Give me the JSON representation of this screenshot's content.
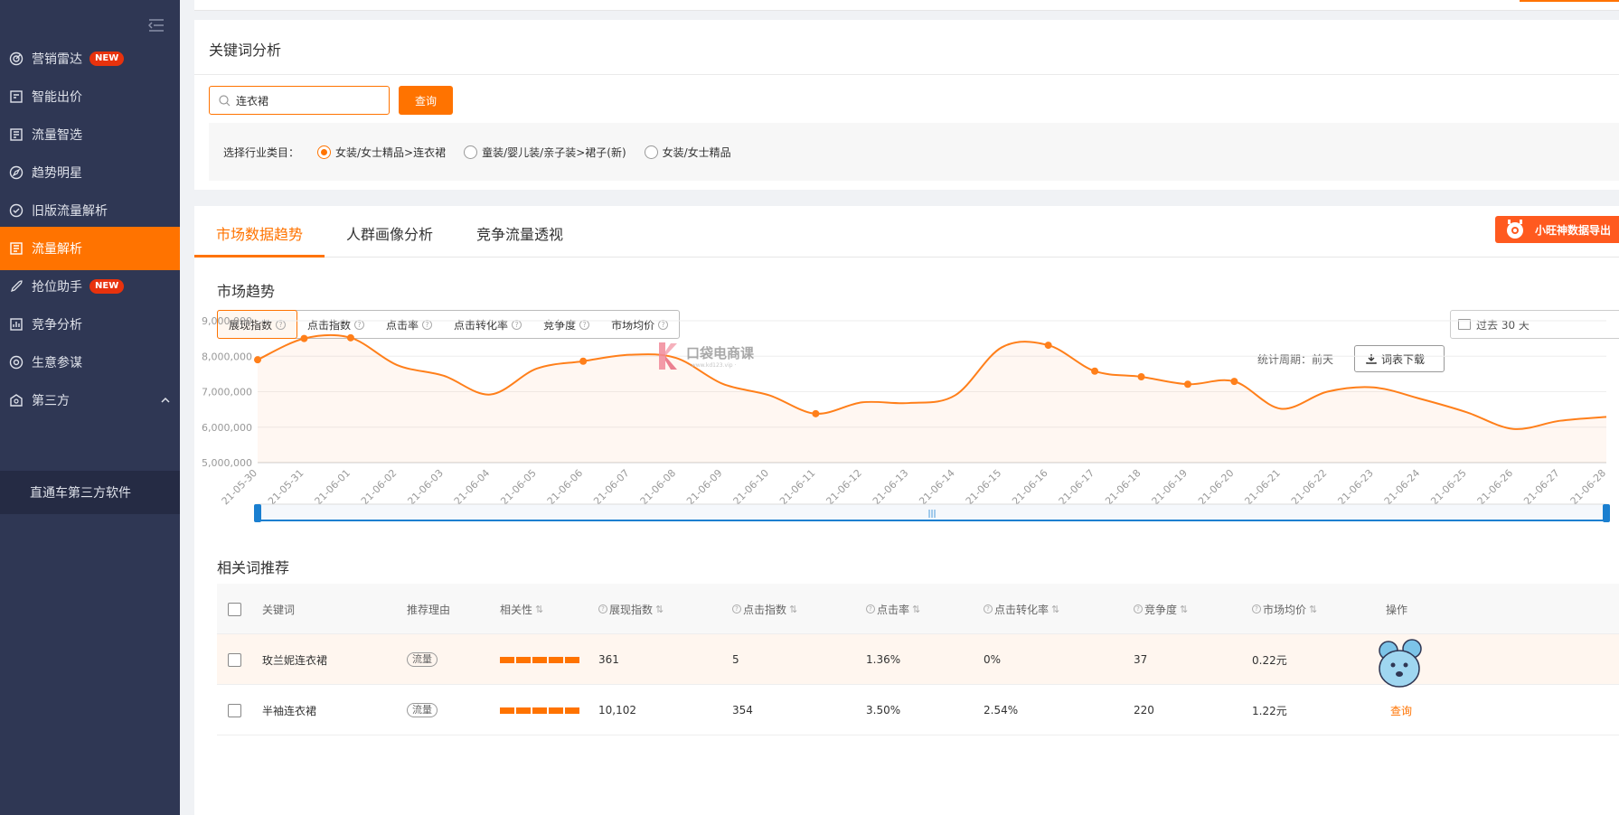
{
  "sidebar": {
    "items": [
      {
        "label": "营销雷达",
        "badge": "NEW",
        "icon": "radar-icon"
      },
      {
        "label": "智能出价",
        "badge": "",
        "icon": "bid-icon"
      },
      {
        "label": "流量智选",
        "badge": "",
        "icon": "traffic-select-icon"
      },
      {
        "label": "趋势明星",
        "badge": "",
        "icon": "trend-star-icon"
      },
      {
        "label": "旧版流量解析",
        "badge": "",
        "icon": "old-analysis-icon"
      },
      {
        "label": "流量解析",
        "badge": "",
        "icon": "analysis-icon",
        "active": true
      },
      {
        "label": "抢位助手",
        "badge": "NEW",
        "icon": "rocket-icon"
      },
      {
        "label": "竞争分析",
        "badge": "",
        "icon": "compete-icon"
      },
      {
        "label": "生意参谋",
        "badge": "",
        "icon": "advisor-icon"
      },
      {
        "label": "第三方",
        "badge": "",
        "icon": "third-party-icon",
        "expanded": true
      }
    ],
    "sub_item": "直通车第三方软件"
  },
  "keyword_card": {
    "title": "关键词分析",
    "search_value": "连衣裙",
    "query_label": "查询",
    "industry_label": "选择行业类目：",
    "industries": [
      {
        "label": "女装/女士精品>连衣裙",
        "checked": true
      },
      {
        "label": "童装/婴儿装/亲子装>裙子(新)",
        "checked": false
      },
      {
        "label": "女装/女士精品",
        "checked": false
      }
    ]
  },
  "tabs": [
    "市场数据趋势",
    "人群画像分析",
    "竞争流量透视"
  ],
  "export_label": "小旺神数据导出",
  "market": {
    "title": "市场趋势",
    "metric_tabs": [
      "展现指数",
      "点击指数",
      "点击率",
      "点击转化率",
      "竞争度",
      "市场均价"
    ],
    "date_range": "过去 30 天"
  },
  "chart_data": {
    "type": "line",
    "series": [
      {
        "name": "展现指数",
        "values": [
          7900000,
          8500000,
          8520000,
          7750000,
          7450000,
          6920000,
          7650000,
          7860000,
          8040000,
          7950000,
          7220000,
          6900000,
          6380000,
          6700000,
          6680000,
          6900000,
          8250000,
          8310000,
          7580000,
          7420000,
          7210000,
          7290000,
          6520000,
          7000000,
          7120000,
          6800000,
          6420000,
          5950000,
          6180000,
          6290000
        ]
      }
    ],
    "x": [
      "21-05-30",
      "21-05-31",
      "21-06-01",
      "21-06-02",
      "21-06-03",
      "21-06-04",
      "21-06-05",
      "21-06-06",
      "21-06-07",
      "21-06-08",
      "21-06-09",
      "21-06-10",
      "21-06-11",
      "21-06-12",
      "21-06-13",
      "21-06-14",
      "21-06-15",
      "21-06-16",
      "21-06-17",
      "21-06-18",
      "21-06-19",
      "21-06-20",
      "21-06-21",
      "21-06-22",
      "21-06-23",
      "21-06-24",
      "21-06-25",
      "21-06-26",
      "21-06-27",
      "21-06-28"
    ],
    "y_ticks": [
      "5,000,000",
      "6,000,000",
      "7,000,000",
      "8,000,000",
      "9,000,000"
    ],
    "ylim": [
      5000000,
      9000000
    ],
    "markers": [
      0,
      1,
      2,
      7,
      12,
      17,
      18,
      19,
      20,
      21
    ],
    "color": "#ff7f1a",
    "grid": true
  },
  "watermark": {
    "text": "口袋电商课",
    "sub": "· www.kd123.vip ·"
  },
  "related": {
    "title": "相关词推荐",
    "period": "统计周期：前天",
    "download_label": "词表下载",
    "columns": [
      "关键词",
      "推荐理由",
      "相关性",
      "展现指数",
      "点击指数",
      "点击率",
      "点击转化率",
      "竞争度",
      "市场均价",
      "操作"
    ],
    "rows": [
      {
        "keyword": "玫兰妮连衣裙",
        "reason": "流量",
        "relevance": 5,
        "impressions": "361",
        "clicks": "5",
        "ctr": "1.36%",
        "cvr": "0%",
        "competition": "37",
        "price": "0.22元",
        "action": ""
      },
      {
        "keyword": "半袖连衣裙",
        "reason": "流量",
        "relevance": 5,
        "impressions": "10,102",
        "clicks": "354",
        "ctr": "3.50%",
        "cvr": "2.54%",
        "competition": "220",
        "price": "1.22元",
        "action": "查询"
      }
    ]
  }
}
